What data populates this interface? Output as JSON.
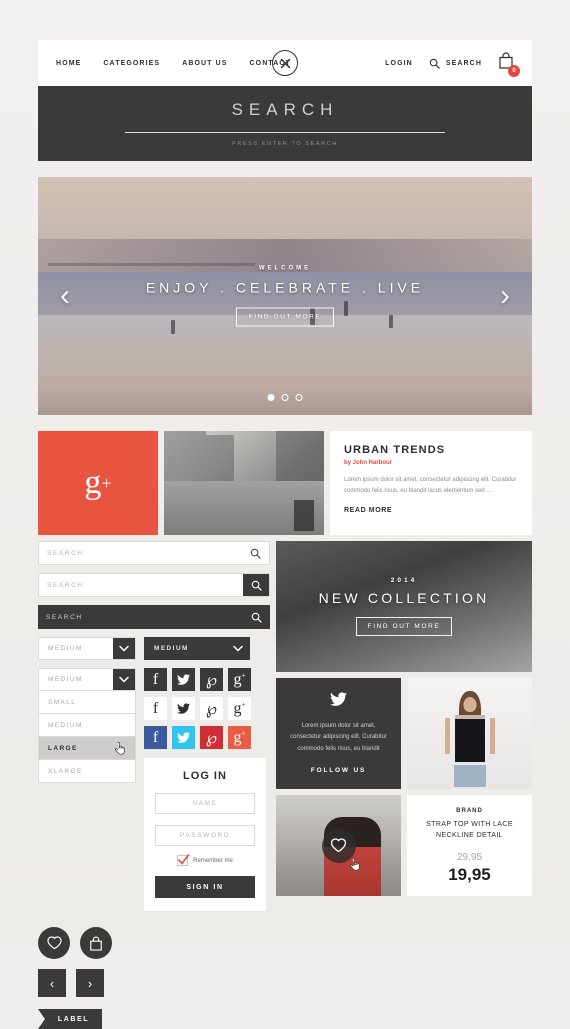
{
  "nav": {
    "links": [
      "HOME",
      "CATEGORIES",
      "ABOUT US",
      "CONTACT"
    ],
    "login_label": "LOGIN",
    "search_label": "SEARCH",
    "cart_count": "0",
    "close_icon": "close-x-icon"
  },
  "search_panel": {
    "title": "SEARCH",
    "hint": "PRESS ENTER TO SEARCH"
  },
  "hero": {
    "welcome": "WELCOME",
    "title": "ENJOY . CELEBRATE . LIVE",
    "button": "FIND OUT MORE",
    "prev": "‹",
    "next": "›",
    "dots": 3,
    "active_dot": 0
  },
  "row1": {
    "gplus_label": "g",
    "gplus_sup": "+",
    "gplus_color": "#e8543f",
    "article": {
      "title": "URBAN TRENDS",
      "author": "by John Harbour",
      "author_color": "#e8453c",
      "body": "Lorem ipsum dolor sit amet, consectetur adipiscing elit. Curabitur commodo felis risus, eu blandit lacus elementum sed ...",
      "read_more": "READ MORE"
    }
  },
  "forms": {
    "search_fields": [
      {
        "placeholder": "SEARCH",
        "style": "plain"
      },
      {
        "placeholder": "SEARCH",
        "style": "split"
      },
      {
        "placeholder": "SEARCH",
        "style": "dark"
      }
    ],
    "selects": [
      {
        "value": "MEDIUM",
        "style": "light"
      },
      {
        "value": "MEDIUM",
        "style": "dark"
      }
    ],
    "dropdown": {
      "value": "MEDIUM",
      "options": [
        "SMALL",
        "MEDIUM",
        "LARGE",
        "XLARGE"
      ],
      "highlighted": "LARGE"
    }
  },
  "social": {
    "rows": [
      {
        "style": "dark",
        "items": [
          "facebook-icon",
          "twitter-icon",
          "pinterest-icon",
          "googleplus-icon"
        ]
      },
      {
        "style": "light",
        "items": [
          "facebook-icon",
          "twitter-icon",
          "pinterest-icon",
          "googleplus-icon"
        ]
      },
      {
        "style": "color",
        "items": [
          "facebook-icon",
          "twitter-icon",
          "pinterest-icon",
          "googleplus-icon"
        ]
      }
    ],
    "glyphs": [
      "f",
      "🐦",
      "℘",
      "g"
    ],
    "colors": [
      "#3b5a9b",
      "#32c3ee",
      "#cf2e36",
      "#ea5c43"
    ]
  },
  "login": {
    "title": "LOG IN",
    "name_placeholder": "NAME",
    "password_placeholder": "PASSWORD",
    "remember_label": "Remember me",
    "remember_checked": true,
    "submit": "SIGN IN"
  },
  "widgets": {
    "heart_icon": "heart-icon",
    "bag_icon": "shopping-bag-icon",
    "prev": "‹",
    "next": "›",
    "label": "LABEL"
  },
  "collection": {
    "year": "2014",
    "title": "NEW COLLECTION",
    "button": "FIND OUT MORE"
  },
  "twitter_card": {
    "icon": "twitter-icon",
    "body": "Lorem ipsum dolor sit amet, consectetur adipiscing elit. Curabitur commodo felis risus, eu blandit",
    "follow": "FOLLOW US"
  },
  "product": {
    "brand": "BRAND",
    "name": "STRAP TOP WITH LACE NECKLINE DETAIL",
    "old_price": "29,95",
    "new_price": "19,95"
  },
  "theme": {
    "dark": "#3a3a3a",
    "accent_red": "#e8453c",
    "page_bg": "#f0eeec",
    "card_bg": "#ffffff"
  }
}
